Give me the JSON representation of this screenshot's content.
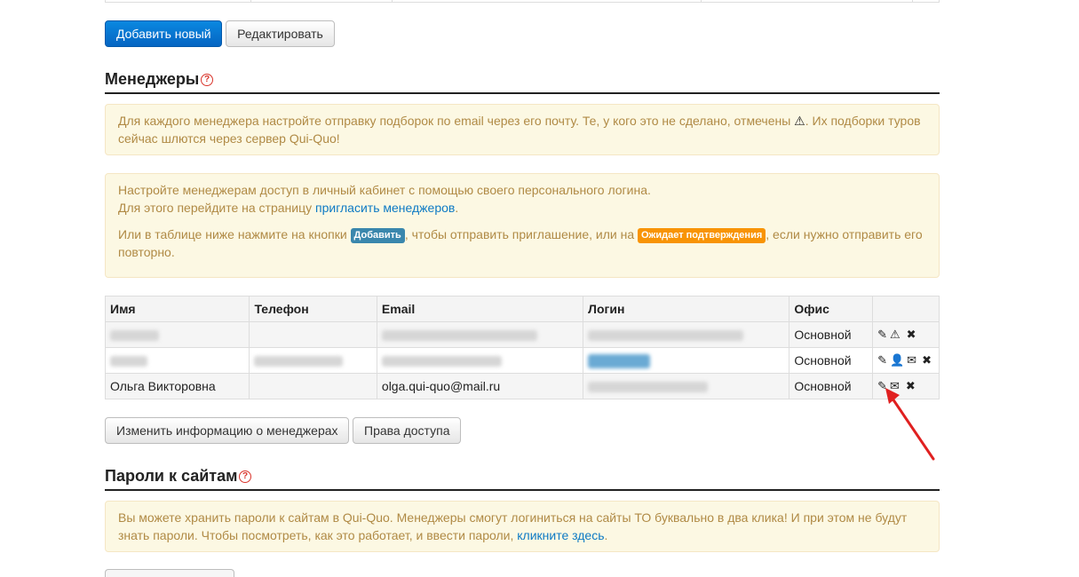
{
  "buttons_top": {
    "add_new": "Добавить новый",
    "edit": "Редактировать"
  },
  "managers_section": {
    "title": "Менеджеры",
    "help": "?",
    "alert1": {
      "text1": "Для каждого менеджера настройте отправку подборок по email через его почту. Те, у кого это не сделано, отмечены ",
      "warn_icon": "⚠",
      "text2": ". Их подборки туров сейчас шлются через сервер Qui-Quo!"
    },
    "alert2": {
      "line1": "Настройте менеджерам доступ в личный кабинет с помощью своего персонального логина.",
      "line2_pre": "Для этого перейдите на страницу ",
      "line2_link": "пригласить менеджеров",
      "line2_post": ".",
      "line3_pre": "Или в таблице ниже нажмите на кнопки ",
      "badge_add": "Добавить",
      "line3_mid": ", чтобы отправить приглашение, или на ",
      "badge_wait": "Ожидает подтверждения",
      "line3_post": ", если нужно отправить его повторно."
    },
    "table": {
      "columns": [
        "Имя",
        "Телефон",
        "Email",
        "Логин",
        "Офис"
      ],
      "rows": [
        {
          "name": "",
          "phone": "",
          "email": "",
          "login": "",
          "office": "Основной"
        },
        {
          "name": "",
          "phone": "",
          "email": "",
          "login": "",
          "office": "Основной"
        },
        {
          "name": "Ольга Викторовна",
          "phone": "",
          "email": "olga.qui-quo@mail.ru",
          "login": "",
          "office": "Основной"
        }
      ],
      "row_icons": [
        [
          "edit-icon",
          "warning-icon",
          "delete-icon"
        ],
        [
          "edit-icon",
          "user-icon",
          "mail-icon",
          "delete-icon"
        ],
        [
          "edit-icon",
          "mail-icon",
          "delete-icon"
        ]
      ]
    },
    "buttons": {
      "change_info": "Изменить информацию о менеджерах",
      "access": "Права доступа"
    }
  },
  "passwords_section": {
    "title": "Пароли к сайтам",
    "help": "?",
    "alert_pre": "Вы можете хранить пароли к сайтам в Qui-Quo. Менеджеры смогут логиниться на сайты ТО буквально в два клика! И при этом не будут знать пароли. Чтобы посмотреть, как это работает, и ввести пароли, ",
    "alert_link": "кликните здесь",
    "alert_post": "."
  },
  "annotation_color": "#e02020"
}
